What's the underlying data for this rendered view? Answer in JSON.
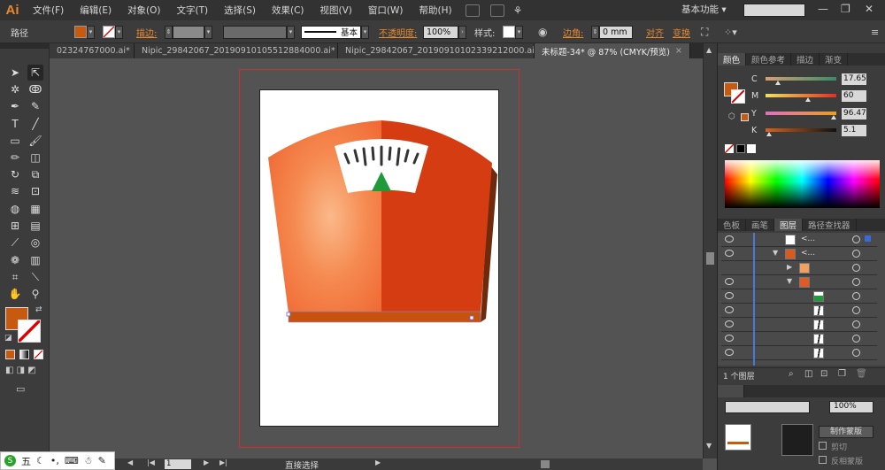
{
  "app": {
    "logo": "Ai",
    "menu": [
      "文件(F)",
      "编辑(E)",
      "对象(O)",
      "文字(T)",
      "选择(S)",
      "效果(C)",
      "视图(V)",
      "窗口(W)",
      "帮助(H)"
    ],
    "workspace": "基本功能",
    "workspace_arrow": "▾"
  },
  "control_bar": {
    "object_type": "路径",
    "stroke_label": "描边:",
    "brush_label": "基本",
    "opacity_label": "不透明度:",
    "opacity_value": "100%",
    "style_label": "样式:",
    "corner_label": "边角:",
    "corner_value": "0 mm",
    "align_label": "对齐",
    "transform_label": "变换"
  },
  "tabs": [
    {
      "label": "02324767000.ai*",
      "active": false
    },
    {
      "label": "Nipic_29842067_20190910105512884000.ai*",
      "active": false
    },
    {
      "label": "Nipic_29842067_20190910102339212000.ai*",
      "active": false
    },
    {
      "label": "未标题-34* @ 87% (CMYK/预览)",
      "active": true
    }
  ],
  "tab_close": "×",
  "color_panel": {
    "tabs": [
      "颜色",
      "颜色参考",
      "描边",
      "渐变"
    ],
    "sliders": [
      {
        "label": "C",
        "value": "17.65",
        "fraction": 0.18
      },
      {
        "label": "M",
        "value": "60",
        "fraction": 0.6
      },
      {
        "label": "Y",
        "value": "96.47",
        "fraction": 0.96
      },
      {
        "label": "K",
        "value": "5.1",
        "fraction": 0.05
      }
    ],
    "fill_color": "#c85a10"
  },
  "layers_panel": {
    "tabs": [
      "色板",
      "画笔",
      "图层",
      "路径查找器"
    ],
    "rows": [
      {
        "name": "<...",
        "indent": 0
      },
      {
        "name": "<...",
        "indent": 0
      },
      {
        "name": "",
        "indent": 1
      },
      {
        "name": "",
        "indent": 1
      },
      {
        "name": "",
        "indent": 2
      },
      {
        "name": "",
        "indent": 2
      },
      {
        "name": "",
        "indent": 2
      },
      {
        "name": "",
        "indent": 2
      },
      {
        "name": "",
        "indent": 2
      }
    ],
    "footer": "1 个图层"
  },
  "transparency_panel": {
    "opacity": "100%",
    "make_mask": "制作蒙版",
    "clip": "剪切",
    "invert": "反相蒙版"
  },
  "status": {
    "zoom": "87%",
    "page": "1",
    "tool": "直接选择"
  },
  "colors": {
    "accent": "#e8892e",
    "scale_left": "#f06a35",
    "scale_right": "#d63c12",
    "scale_base": "#c8520d",
    "needle": "#1e9a3a",
    "bleed": "#c83232"
  }
}
